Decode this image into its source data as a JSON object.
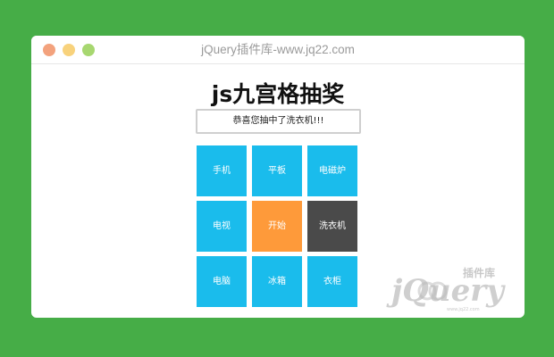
{
  "window": {
    "title": "jQuery插件库-www.jq22.com"
  },
  "page": {
    "title": "js九宫格抽奖",
    "result_text": "恭喜您抽中了洗衣机!!!"
  },
  "grid": {
    "cells": [
      {
        "label": "手机",
        "state": "normal"
      },
      {
        "label": "平板",
        "state": "normal"
      },
      {
        "label": "电磁炉",
        "state": "normal"
      },
      {
        "label": "电视",
        "state": "normal"
      },
      {
        "label": "开始",
        "state": "start"
      },
      {
        "label": "洗衣机",
        "state": "highlighted"
      },
      {
        "label": "电脑",
        "state": "normal"
      },
      {
        "label": "冰箱",
        "state": "normal"
      },
      {
        "label": "衣柜",
        "state": "normal"
      }
    ]
  },
  "watermark": {
    "brand": "jQuery",
    "subtitle": "插件库",
    "tagline": "www.jq22.com"
  },
  "colors": {
    "background": "#46ad47",
    "cell": "#1abcec",
    "start": "#fe9a3a",
    "highlighted": "#4a4a4a",
    "dot_close": "#f3a27d",
    "dot_minimize": "#f8d27c",
    "dot_maximize": "#a7d770"
  }
}
